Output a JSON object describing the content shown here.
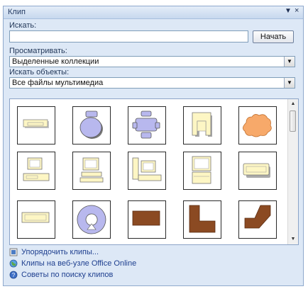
{
  "pane": {
    "title": "Клип"
  },
  "search": {
    "label": "Искать:",
    "value": "",
    "button": "Начать"
  },
  "browse": {
    "label": "Просматривать:",
    "selected": "Выделенные коллекции"
  },
  "objects": {
    "label": "Искать объекты:",
    "selected": "Все файлы мультимедиа"
  },
  "gallery": {
    "clips": [
      {
        "name": "desk-clip-icon"
      },
      {
        "name": "round-table-chairs-clip-icon"
      },
      {
        "name": "table-chairs-clip-icon"
      },
      {
        "name": "armchair-clip-icon"
      },
      {
        "name": "cloud-shape-clip-icon"
      },
      {
        "name": "computer-desk-clip-icon"
      },
      {
        "name": "computer-workstation-clip-icon"
      },
      {
        "name": "computer-station-clip-icon"
      },
      {
        "name": "computer-clip-icon"
      },
      {
        "name": "sofa-clip-icon"
      },
      {
        "name": "long-sofa-clip-icon"
      },
      {
        "name": "round-table-clip-icon"
      },
      {
        "name": "rectangle-desk-clip-icon"
      },
      {
        "name": "corner-desk-clip-icon"
      },
      {
        "name": "angled-desk-clip-icon"
      }
    ]
  },
  "links": {
    "organize": "Упорядочить клипы...",
    "online": "Клипы на веб-узле Office Online",
    "tips": "Советы по поиску клипов"
  },
  "colors": {
    "accent": "#dde8f6",
    "link": "#1e3f8f",
    "furniture": "#fdf6c4",
    "shape": "#f7a96a",
    "wood": "#8b4a22",
    "purple": "#b8b8ee"
  }
}
